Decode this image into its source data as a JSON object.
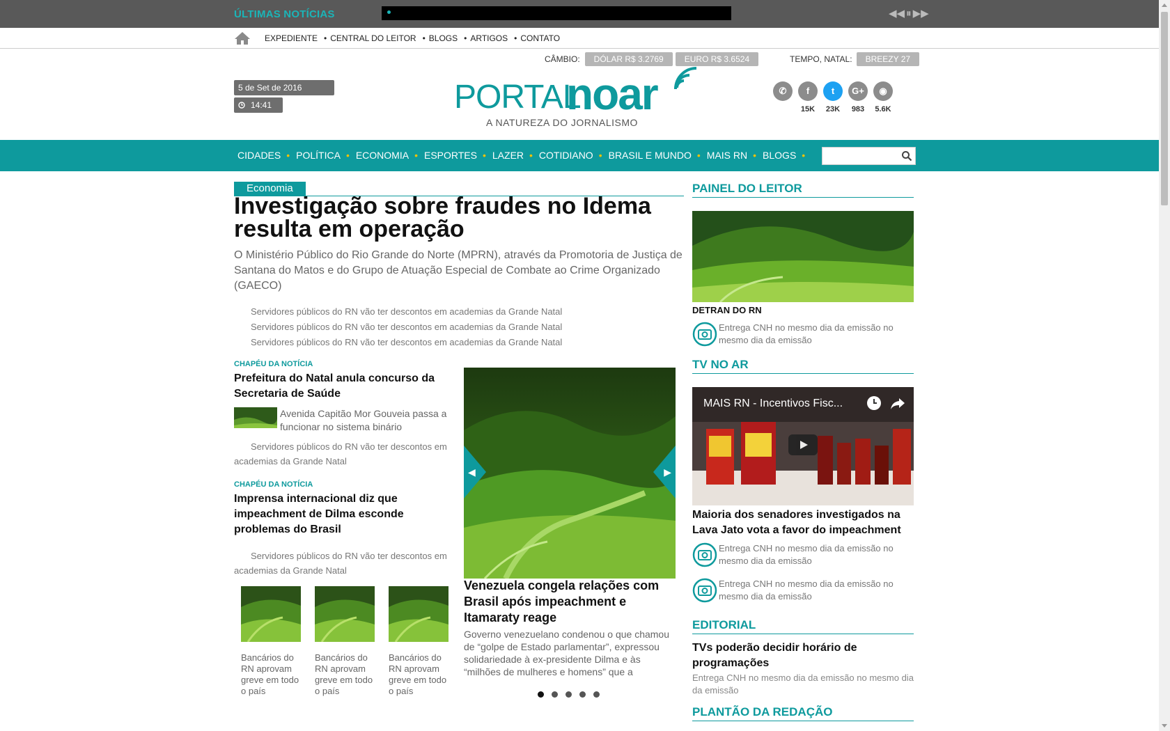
{
  "topbar": {
    "label": "ÚLTIMAS NOTÍCIAS"
  },
  "secnav": {
    "items": [
      "EXPEDIENTE",
      "CENTRAL DO LEITOR",
      "BLOGS",
      "ARTIGOS",
      "CONTATO"
    ]
  },
  "header": {
    "cambio_label": "CÂMBIO:",
    "dolar": "DÓLAR R$ 3.2769",
    "euro": "EURO R$ 3.6524",
    "tempo_label": "TEMPO, NATAL:",
    "tempo": "BREEZY 27",
    "date": "5 de Set de 2016",
    "time": "14:41",
    "logo_portal": "PORTAL",
    "logo_noar": "noar",
    "logo_tagline": "A NATUREZA DO JORNALISMO",
    "social": [
      {
        "icon": "whatsapp-icon",
        "glyph": "✆",
        "count": ""
      },
      {
        "icon": "facebook-icon",
        "glyph": "f",
        "count": "15K"
      },
      {
        "icon": "twitter-icon",
        "glyph": "t",
        "count": "23K"
      },
      {
        "icon": "google-plus-icon",
        "glyph": "G+",
        "count": "983"
      },
      {
        "icon": "rss-icon",
        "glyph": "◉",
        "count": "5.6K"
      }
    ]
  },
  "mainnav": {
    "items": [
      "CIDADES",
      "POLÍTICA",
      "ECONOMIA",
      "ESPORTES",
      "LAZER",
      "COTIDIANO",
      "BRASIL E MUNDO",
      "MAIS RN",
      "BLOGS"
    ]
  },
  "lead": {
    "category": "Economia",
    "headline": "Investigação sobre fraudes no Idema resulta em operação",
    "lede": "O Ministério Público do Rio Grande do Norte (MPRN), através da Promotoria de Justiça de Santana do Matos e do Grupo de Atuação Especial de Combate ao Crime Organizado (GAECO)",
    "related": [
      "Servidores públicos do RN vão ter descontos em academias da Grande Natal",
      "Servidores públicos do RN vão ter descontos em academias da Grande Natal",
      "Servidores públicos do RN vão ter descontos em academias da Grande Natal"
    ]
  },
  "sub1": {
    "chapeu": "CHAPÉU DA NOTÍCIA",
    "title": "Prefeitura do Natal anula concurso da Secretaria de Saúde",
    "thumb_text": "Avenida Capitão Mor Gouveia passa a funcionar no sistema binário",
    "extra": "Servidores públicos do RN vão ter descontos em academias da Grande Natal"
  },
  "sub2": {
    "chapeu": "CHAPÉU DA NOTÍCIA",
    "title": "Imprensa internacional diz que impeachment de Dilma esconde problemas do Brasil",
    "extra": "Servidores públicos do RN vão ter descontos em academias da Grande Natal"
  },
  "gallery": [
    "Bancários do RN aprovam greve em todo o país",
    "Bancários do RN aprovam greve em todo o país",
    "Bancários do RN aprovam greve em todo o país"
  ],
  "slider": {
    "title": "Venezuela congela relações com Brasil após impeachment e Itamaraty reage",
    "desc": "Governo venezuelano condenou o que chamou de “golpe de Estado parlamentar”, expressou solidariedade à ex-presidente Dilma e às “milhões de mulheres e homens” que a",
    "pages": 5,
    "active": 0
  },
  "right": {
    "painel_title": "PAINEL DO LEITOR",
    "painel_caption": "DETRAN DO RN",
    "painel_item": "Entrega CNH no mesmo dia da emissão no mesmo dia da emissão",
    "tv_title": "TV NO AR",
    "video_title": "MAIS RN - Incentivos Fisc...",
    "tv_headline": "Maioria dos senadores investigados na Lava Jato vota a favor do impeachment",
    "tv_items": [
      "Entrega CNH no mesmo dia da emissão no mesmo dia da emissão",
      "Entrega CNH no mesmo dia da emissão no mesmo dia da emissão"
    ],
    "editorial_title": "EDITORIAL",
    "editorial_headline": "TVs poderão decidir horário de programações",
    "editorial_text": "Entrega CNH no mesmo dia da emissão no mesmo dia da emissão",
    "plantao_title": "PLANTÃO DA REDAÇÃO"
  },
  "colors": {
    "accent": "#0e9a9d",
    "bullet": "#f2c200",
    "topbar": "#595959"
  }
}
